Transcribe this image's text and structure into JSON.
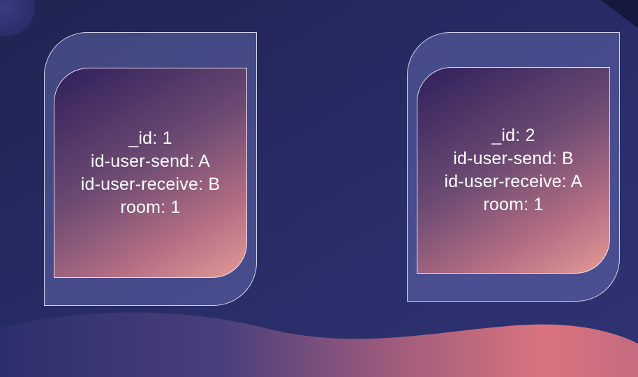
{
  "records": [
    {
      "id_line": "_id: 1",
      "send_line": "id-user-send: A",
      "receive_line": "id-user-receive: B",
      "room_line": "room: 1"
    },
    {
      "id_line": "_id: 2",
      "send_line": "id-user-send: B",
      "receive_line": "id-user-receive: A",
      "room_line": "room: 1"
    }
  ],
  "colors": {
    "background": "#272b62",
    "card_outer": "#4f5590",
    "card_inner_start": "#2f1f5c",
    "card_inner_end": "#e39a96",
    "wave_start": "#3d3a78",
    "wave_end": "#d9737e"
  }
}
